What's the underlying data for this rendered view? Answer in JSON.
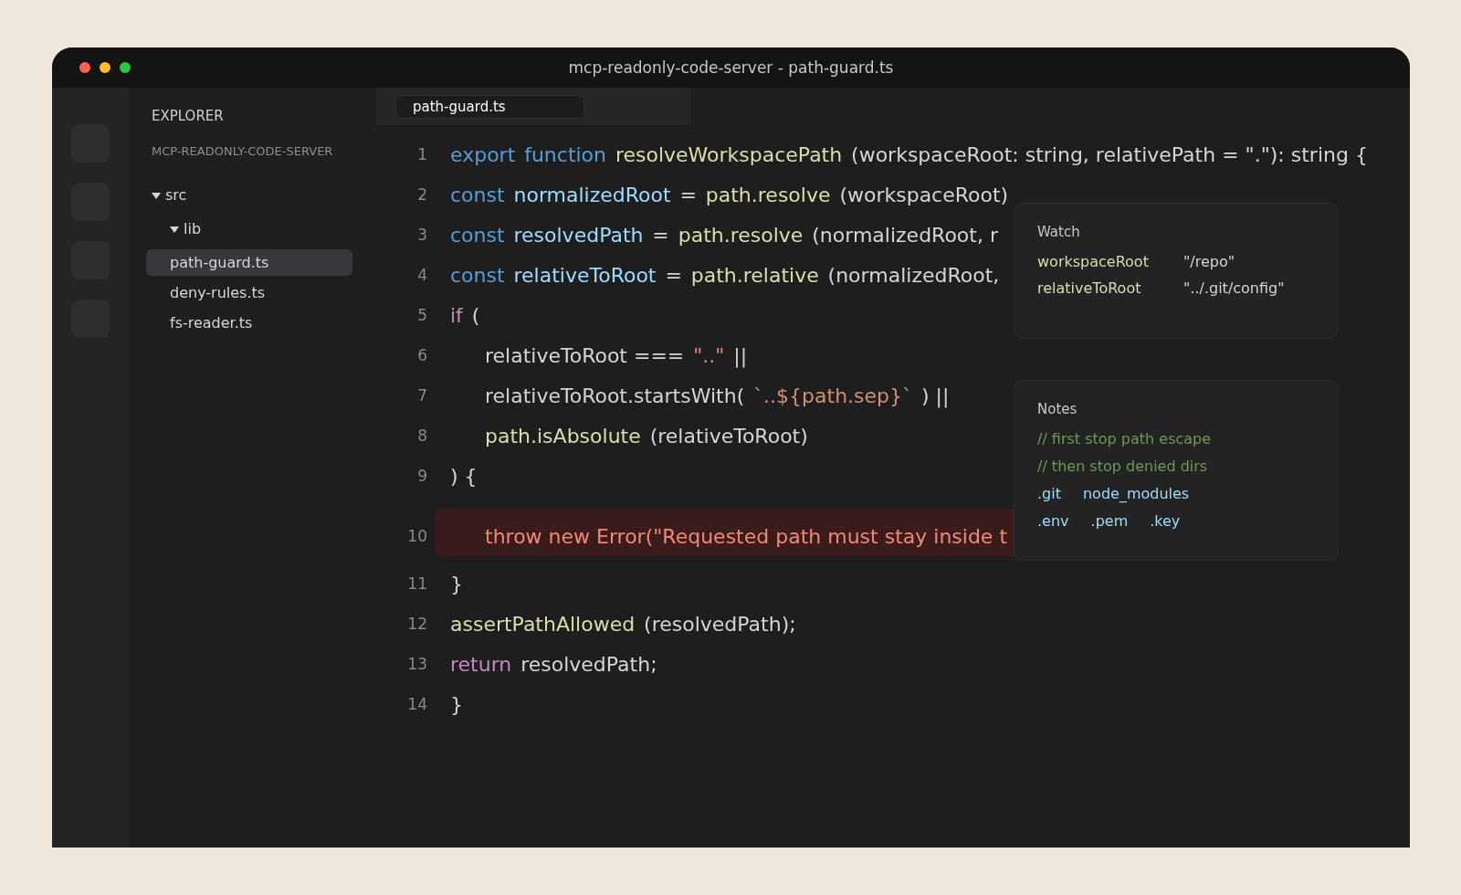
{
  "window": {
    "title": "mcp-readonly-code-server - path-guard.ts"
  },
  "sidebar": {
    "heading": "EXPLORER",
    "project": "MCP-READONLY-CODE-SERVER",
    "tree": [
      {
        "label": "src",
        "expanded": true,
        "selected": false,
        "children": [
          {
            "label": "lib",
            "expanded": true,
            "selected": false,
            "children": [
              {
                "label": "path-guard.ts",
                "selected": true
              },
              {
                "label": "deny-rules.ts",
                "selected": false
              },
              {
                "label": "fs-reader.ts",
                "selected": false
              }
            ]
          }
        ]
      }
    ]
  },
  "tabs": [
    {
      "label": "path-guard.ts",
      "selected": true
    }
  ],
  "editor": {
    "lines": [
      {
        "number": "1",
        "indented": false,
        "highlighted": false,
        "tokens": [
          {
            "kind": "keyword",
            "text": "export"
          },
          {
            "kind": "keyword",
            "text": "function"
          },
          {
            "kind": "function",
            "text": "resolveWorkspacePath"
          },
          {
            "kind": "plain",
            "text": "(workspaceRoot: string, relativePath = \".\"): string {"
          }
        ]
      },
      {
        "number": "2",
        "indented": false,
        "highlighted": false,
        "tokens": [
          {
            "kind": "keyword",
            "text": "const"
          },
          {
            "kind": "variable",
            "text": "normalizedRoot"
          },
          {
            "kind": "plain",
            "text": "="
          },
          {
            "kind": "function",
            "text": "path.resolve"
          },
          {
            "kind": "plain",
            "text": "(workspaceRoot)"
          }
        ]
      },
      {
        "number": "3",
        "indented": false,
        "highlighted": false,
        "tokens": [
          {
            "kind": "keyword",
            "text": "const"
          },
          {
            "kind": "variable",
            "text": "resolvedPath"
          },
          {
            "kind": "plain",
            "text": "="
          },
          {
            "kind": "function",
            "text": "path.resolve"
          },
          {
            "kind": "plain",
            "text": "(normalizedRoot, r"
          }
        ]
      },
      {
        "number": "4",
        "indented": false,
        "highlighted": false,
        "tokens": [
          {
            "kind": "keyword",
            "text": "const"
          },
          {
            "kind": "variable",
            "text": "relativeToRoot"
          },
          {
            "kind": "plain",
            "text": "="
          },
          {
            "kind": "function",
            "text": "path.relative"
          },
          {
            "kind": "plain",
            "text": "(normalizedRoot,"
          }
        ]
      },
      {
        "number": "5",
        "indented": false,
        "highlighted": false,
        "tokens": [
          {
            "kind": "control",
            "text": "if"
          },
          {
            "kind": "plain",
            "text": "("
          }
        ]
      },
      {
        "number": "6",
        "indented": true,
        "highlighted": false,
        "tokens": [
          {
            "kind": "plain",
            "text": "relativeToRoot ==="
          },
          {
            "kind": "string",
            "text": "\"..\""
          },
          {
            "kind": "plain",
            "text": "||"
          }
        ]
      },
      {
        "number": "7",
        "indented": true,
        "highlighted": false,
        "tokens": [
          {
            "kind": "plain",
            "text": "relativeToRoot.startsWith("
          },
          {
            "kind": "string",
            "text": "`..${path.sep}`"
          },
          {
            "kind": "plain",
            "text": ") ||"
          }
        ]
      },
      {
        "number": "8",
        "indented": true,
        "highlighted": false,
        "tokens": [
          {
            "kind": "function",
            "text": "path.isAbsolute"
          },
          {
            "kind": "plain",
            "text": "(relativeToRoot)"
          }
        ]
      },
      {
        "number": "9",
        "indented": false,
        "highlighted": false,
        "tokens": [
          {
            "kind": "plain",
            "text": ") {"
          }
        ]
      },
      {
        "number": "10",
        "indented": true,
        "highlighted": true,
        "tokens": [
          {
            "kind": "error",
            "text": "throw new Error(\"Requested path must stay inside t"
          }
        ]
      },
      {
        "number": "11",
        "indented": false,
        "highlighted": false,
        "tokens": [
          {
            "kind": "plain",
            "text": "}"
          }
        ]
      },
      {
        "number": "12",
        "indented": false,
        "highlighted": false,
        "tokens": [
          {
            "kind": "function",
            "text": "assertPathAllowed"
          },
          {
            "kind": "plain",
            "text": "(resolvedPath);"
          }
        ]
      },
      {
        "number": "13",
        "indented": false,
        "highlighted": false,
        "tokens": [
          {
            "kind": "control",
            "text": "return"
          },
          {
            "kind": "plain",
            "text": "resolvedPath;"
          }
        ]
      },
      {
        "number": "14",
        "indented": false,
        "highlighted": false,
        "tokens": [
          {
            "kind": "plain",
            "text": "}"
          }
        ]
      }
    ]
  },
  "watch": {
    "title": "Watch",
    "rows": [
      {
        "name": "workspaceRoot",
        "value": "\"/repo\""
      },
      {
        "name": "relativeToRoot",
        "value": "\"../.git/config\""
      }
    ]
  },
  "notes": {
    "title": "Notes",
    "comments": [
      "// first stop path escape",
      "// then stop denied dirs"
    ],
    "denied": [
      [
        ".git",
        "node_modules"
      ],
      [
        ".env",
        ".pem",
        ".key"
      ]
    ]
  }
}
